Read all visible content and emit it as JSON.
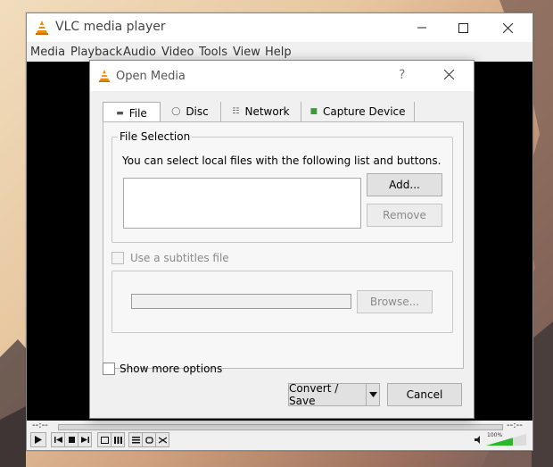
{
  "main_window": {
    "title": "VLC media player",
    "menu": [
      "Media",
      "Playback",
      "Audio",
      "Video",
      "Tools",
      "View",
      "Help"
    ],
    "time_elapsed": "--:--",
    "time_total": "--:--",
    "volume": "100%"
  },
  "dialog": {
    "title": "Open Media",
    "help": "?",
    "tabs": [
      {
        "label": "File",
        "icon": "folder-icon"
      },
      {
        "label": "Disc",
        "icon": "disc-icon"
      },
      {
        "label": "Network",
        "icon": "network-icon"
      },
      {
        "label": "Capture Device",
        "icon": "capture-device-icon"
      }
    ],
    "file_selection": {
      "title": "File Selection",
      "description": "You can select local files with the following list and buttons.",
      "add_label": "Add...",
      "remove_label": "Remove"
    },
    "subtitles": {
      "checkbox_label": "Use a subtitles file",
      "browse_label": "Browse..."
    },
    "show_more_label": "Show more options",
    "convert_save_label": "Convert / Save",
    "cancel_label": "Cancel"
  },
  "colors": {
    "accent_orange": "#f08a00",
    "volume_green": "#2db52d"
  }
}
